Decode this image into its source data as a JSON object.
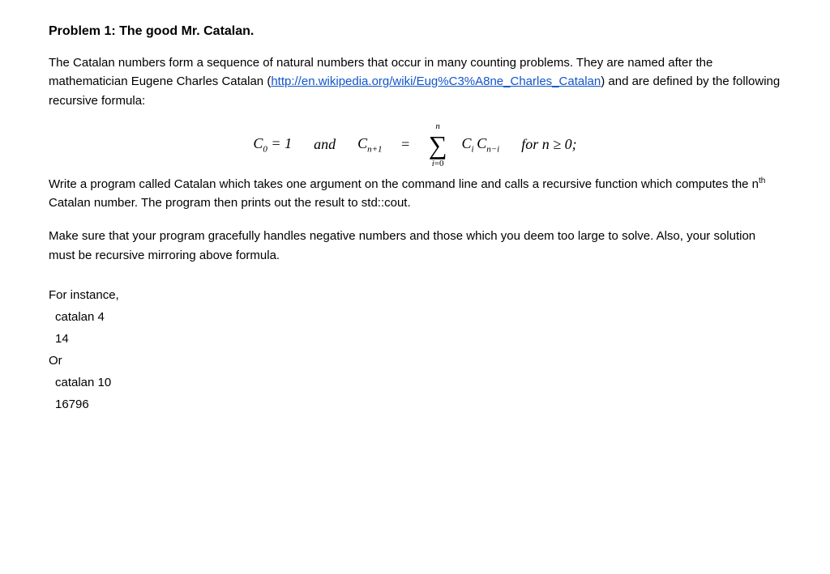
{
  "page": {
    "problem_title": "Problem 1:  The good Mr. Catalan.",
    "intro_text_1": "The Catalan numbers form a sequence of natural numbers that occur in many counting problems.  They are named after the mathematician Eugene Charles Catalan (",
    "link_text": "http://en.wikipedia.org/wiki/Eug%C3%A8ne_Charles_Catalan",
    "link_url": "http://en.wikipedia.org/wiki/Eug%C3%A8ne_Charles_Catalan",
    "intro_text_2": ") and are defined by the following recursive formula:",
    "formula_label": "C₀ = 1   and   C_{n+1} = Σ Cᵢ C_{n-i}   for n ≥ 0;",
    "description_text": "Write a program called Catalan which takes one argument on the command line and calls a recursive function which computes the n",
    "description_th": "th",
    "description_text_2": " Catalan number.  The program then prints out the result to std::cout.",
    "make_sure_text": "Make sure that your program gracefully handles negative numbers and those which you deem too large to solve.  Also, your solution must be recursive mirroring above formula.",
    "for_instance_label": "For instance,",
    "example1_cmd": "catalan 4",
    "example1_result": " 14",
    "or_label": "Or",
    "example2_cmd": "catalan 10",
    "example2_result": " 16796"
  }
}
